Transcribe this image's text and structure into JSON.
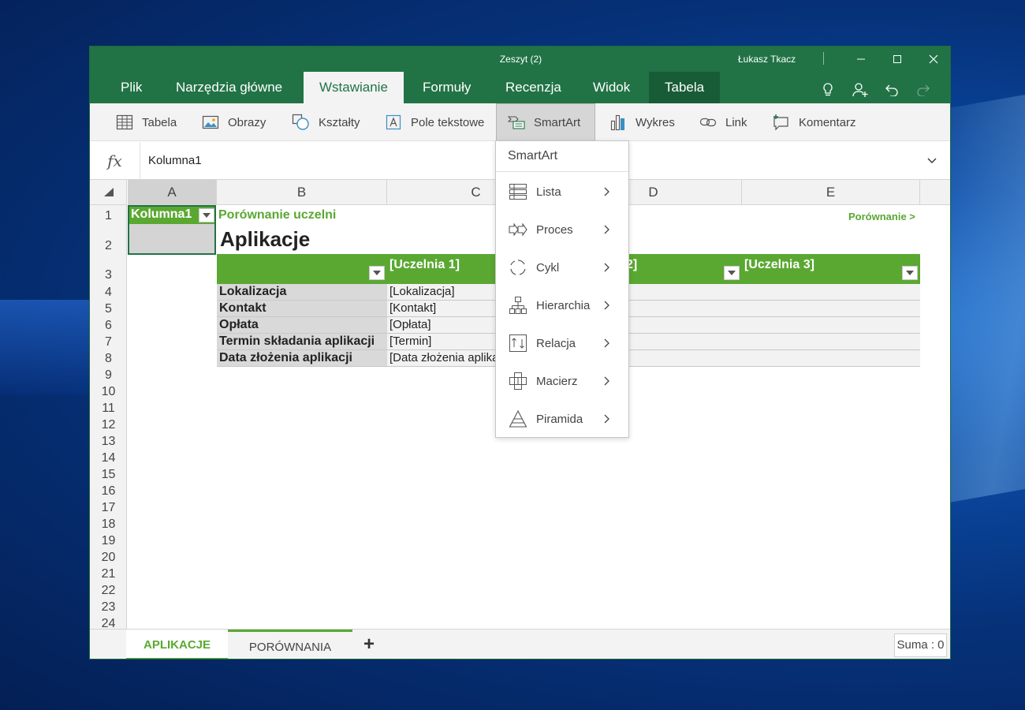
{
  "window": {
    "title": "Zeszyt (2)",
    "user": "Łukasz Tkacz",
    "controls": [
      "minimize-icon",
      "maximize-icon",
      "close-icon"
    ]
  },
  "menu": {
    "tabs": [
      {
        "label": "Plik"
      },
      {
        "label": "Narzędzia główne"
      },
      {
        "label": "Wstawianie",
        "active": true
      },
      {
        "label": "Formuły"
      },
      {
        "label": "Recenzja"
      },
      {
        "label": "Widok"
      },
      {
        "label": "Tabela",
        "contextual": true
      }
    ],
    "right_icons": [
      "lightbulb-icon",
      "share-user-icon",
      "undo-icon",
      "redo-icon"
    ]
  },
  "ribbon": {
    "items": [
      {
        "label": "Tabela",
        "icon": "table-icon"
      },
      {
        "label": "Obrazy",
        "icon": "picture-icon"
      },
      {
        "label": "Kształty",
        "icon": "shapes-icon"
      },
      {
        "label": "Pole tekstowe",
        "icon": "textbox-icon"
      },
      {
        "label": "SmartArt",
        "icon": "smartart-icon",
        "pressed": true
      },
      {
        "label": "Wykres",
        "icon": "chart-icon"
      },
      {
        "label": "Link",
        "icon": "link-icon"
      },
      {
        "label": "Komentarz",
        "icon": "comment-icon"
      }
    ]
  },
  "formula_bar": {
    "fx": "fx",
    "value": "Kolumna1"
  },
  "grid": {
    "columns": [
      "A",
      "B",
      "C",
      "D",
      "E"
    ],
    "rows": [
      "1",
      "2",
      "3",
      "4",
      "5",
      "6",
      "7",
      "8",
      "9",
      "10",
      "11",
      "12",
      "13",
      "14",
      "15",
      "16",
      "17",
      "18",
      "19",
      "20",
      "21",
      "22",
      "23",
      "24"
    ],
    "a1_value": "Kolumna1",
    "subtitle": "Porównanie uczelni",
    "heading": "Aplikacje",
    "link_right": "Porównanie >",
    "table": {
      "headers": [
        "",
        "[Uczelnia 1]",
        "[Uczelnia 2]",
        "[Uczelnia 3]"
      ],
      "visible_header_2": "2]",
      "rows": [
        {
          "label": "Lokalizacja",
          "value": "[Lokalizacja]"
        },
        {
          "label": "Kontakt",
          "value": "[Kontakt]"
        },
        {
          "label": "Opłata",
          "value": "[Opłata]"
        },
        {
          "label": "Termin składania aplikacji",
          "value": "[Termin]"
        },
        {
          "label": "Data złożenia aplikacji",
          "value": "[Data złożenia aplika"
        }
      ]
    }
  },
  "smartart_menu": {
    "title": "SmartArt",
    "items": [
      {
        "label": "Lista",
        "icon": "list-icon"
      },
      {
        "label": "Proces",
        "icon": "process-icon"
      },
      {
        "label": "Cykl",
        "icon": "cycle-icon"
      },
      {
        "label": "Hierarchia",
        "icon": "hierarchy-icon"
      },
      {
        "label": "Relacja",
        "icon": "relationship-icon"
      },
      {
        "label": "Macierz",
        "icon": "matrix-icon"
      },
      {
        "label": "Piramida",
        "icon": "pyramid-icon"
      }
    ]
  },
  "sheets": {
    "tabs": [
      {
        "label": "APLIKACJE",
        "active": true
      },
      {
        "label": "PORÓWNANIA",
        "active": false
      }
    ],
    "add_label": "+",
    "sum": "Suma : 0"
  },
  "colors": {
    "title_bar": "#217346",
    "accent_green": "#5aa832",
    "contextual_tab": "#185c37"
  }
}
